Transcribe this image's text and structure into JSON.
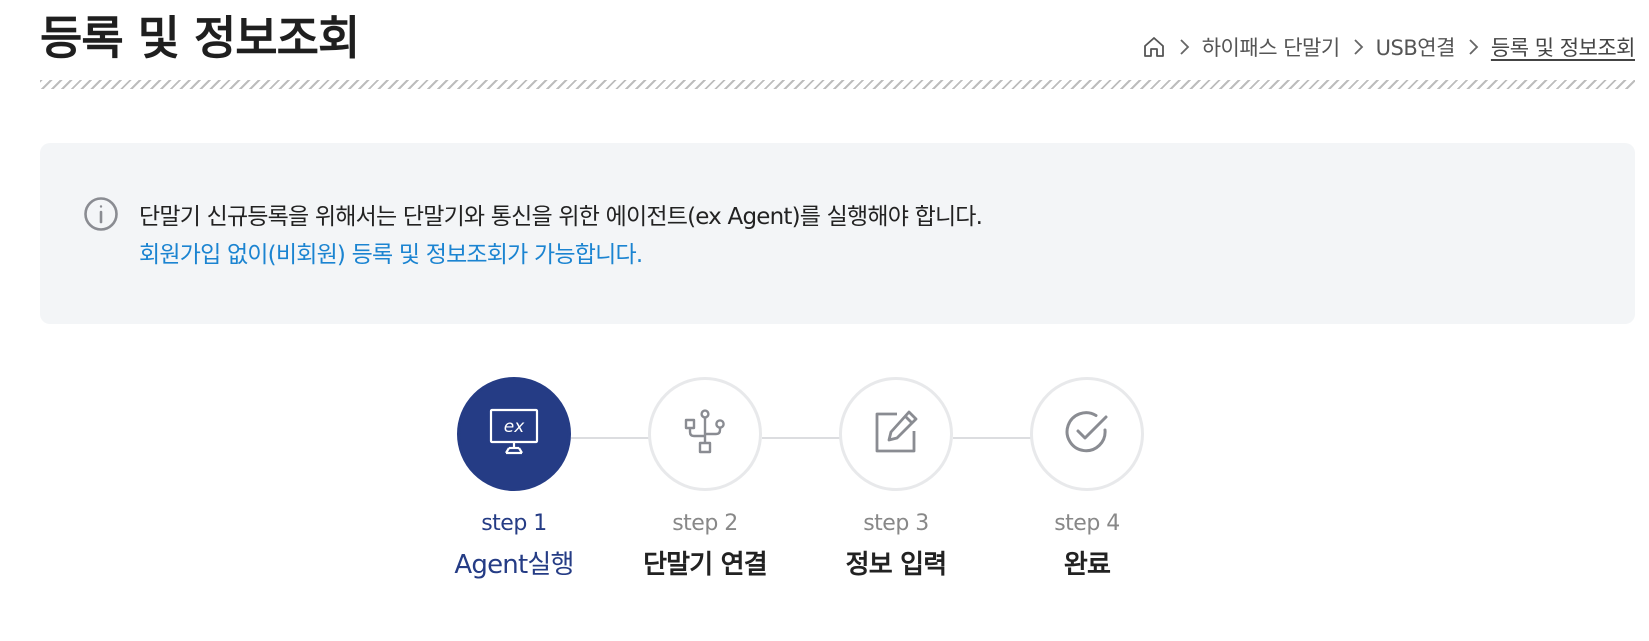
{
  "page": {
    "title": "등록 및 정보조회"
  },
  "breadcrumb": {
    "home_icon": "home-icon",
    "items": [
      "하이패스 단말기",
      "USB연결",
      "등록 및 정보조회"
    ]
  },
  "notice": {
    "icon": "info-icon",
    "line1": "단말기 신규등록을 위해서는 단말기와 통신을 위한 에이전트(ex Agent)를 실행해야 합니다.",
    "line2": "회원가입 없이(비회원) 등록 및 정보조회가 가능합니다."
  },
  "steps": [
    {
      "number": "step 1",
      "name": "Agent실행",
      "icon": "ex-monitor-icon",
      "active": true
    },
    {
      "number": "step 2",
      "name": "단말기 연결",
      "icon": "usb-icon",
      "active": false
    },
    {
      "number": "step 3",
      "name": "정보 입력",
      "icon": "edit-icon",
      "active": false
    },
    {
      "number": "step 4",
      "name": "완료",
      "icon": "check-circle-icon",
      "active": false
    }
  ],
  "colors": {
    "active_step": "#253c85",
    "notice_highlight": "#1b84d1",
    "notice_background": "#f3f5f7",
    "inactive_icon": "#8a8c92"
  },
  "monitor_icon_text": "ex"
}
